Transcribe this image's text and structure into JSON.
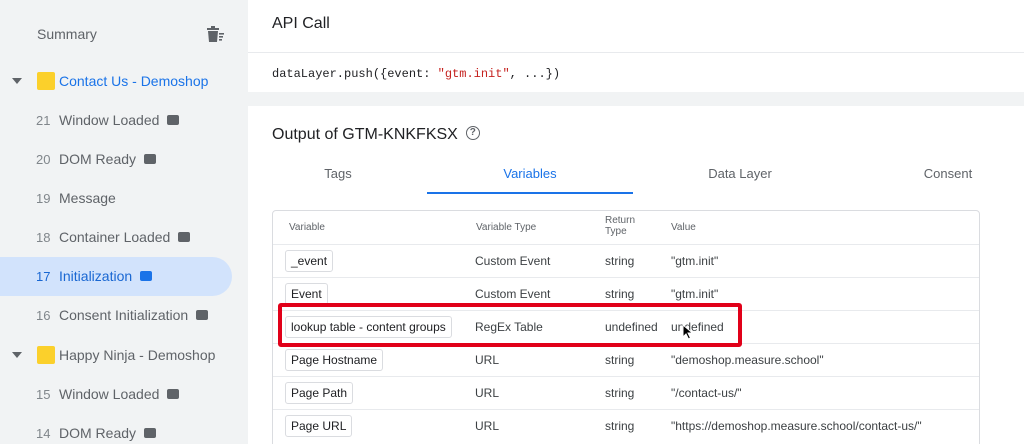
{
  "sidebar": {
    "summary_label": "Summary",
    "groups": [
      {
        "title": "Contact Us - Demoshop",
        "events": [
          {
            "num": "21",
            "label": "Window Loaded",
            "badge": true
          },
          {
            "num": "20",
            "label": "DOM Ready",
            "badge": true
          },
          {
            "num": "19",
            "label": "Message",
            "badge": false
          },
          {
            "num": "18",
            "label": "Container Loaded",
            "badge": true
          },
          {
            "num": "17",
            "label": "Initialization",
            "badge": true
          },
          {
            "num": "16",
            "label": "Consent Initialization",
            "badge": true
          }
        ]
      },
      {
        "title": "Happy Ninja - Demoshop",
        "events": [
          {
            "num": "15",
            "label": "Window Loaded",
            "badge": true
          },
          {
            "num": "14",
            "label": "DOM Ready",
            "badge": true
          }
        ]
      }
    ]
  },
  "api": {
    "title": "API Call",
    "code_prefix": "dataLayer.push({event: ",
    "code_string": "\"gtm.init\"",
    "code_suffix": ", ...})"
  },
  "output": {
    "title": "Output of GTM-KNKFKSX",
    "help_glyph": "?",
    "tabs": [
      "Tags",
      "Variables",
      "Data Layer",
      "Consent"
    ],
    "active_tab": "Variables"
  },
  "table": {
    "headers": {
      "variable": "Variable",
      "type": "Variable Type",
      "return_line1": "Return",
      "return_line2": "Type",
      "value": "Value"
    },
    "rows": [
      {
        "variable": "_event",
        "type": "Custom Event",
        "return": "string",
        "value": "\"gtm.init\""
      },
      {
        "variable": "Event",
        "type": "Custom Event",
        "return": "string",
        "value": "\"gtm.init\""
      },
      {
        "variable": "lookup table - content groups",
        "type": "RegEx Table",
        "return": "undefined",
        "value": "undefined"
      },
      {
        "variable": "Page Hostname",
        "type": "URL",
        "return": "string",
        "value": "\"demoshop.measure.school\""
      },
      {
        "variable": "Page Path",
        "type": "URL",
        "return": "string",
        "value": "\"/contact-us/\""
      },
      {
        "variable": "Page URL",
        "type": "URL",
        "return": "string",
        "value": "\"https://demoshop.measure.school/contact-us/\""
      }
    ]
  },
  "colors": {
    "accent": "#1a73e8",
    "highlight": "#e10019",
    "folder": "#fbd02b",
    "active_bg": "#d2e3fc"
  }
}
